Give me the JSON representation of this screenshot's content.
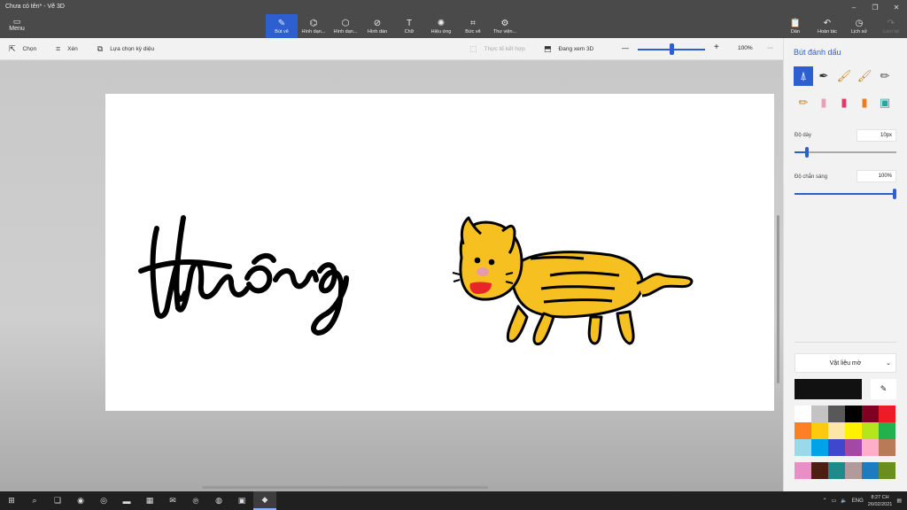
{
  "app": {
    "title": "Chưa có tên* - Vẽ 3D",
    "window_controls": [
      "–",
      "❐",
      "✕"
    ]
  },
  "menu": {
    "label": "Menu"
  },
  "tools": [
    {
      "label": "Bút vẽ",
      "icon": "brush-icon",
      "glyph": "✎",
      "active": true
    },
    {
      "label": "Hình dạn...",
      "icon": "shapes-2d-icon",
      "glyph": "⌬"
    },
    {
      "label": "Hình dạn...",
      "icon": "shapes-3d-icon",
      "glyph": "⬡"
    },
    {
      "label": "Hình dán",
      "icon": "stickers-icon",
      "glyph": "⊘"
    },
    {
      "label": "Chữ",
      "icon": "text-icon",
      "glyph": "T"
    },
    {
      "label": "Hiệu ứng",
      "icon": "effects-icon",
      "glyph": "✺"
    },
    {
      "label": "Bức vẽ",
      "icon": "canvas-icon",
      "glyph": "⌗"
    },
    {
      "label": "Thư viện...",
      "icon": "library-icon",
      "glyph": "⚙"
    }
  ],
  "right_tools": [
    {
      "label": "Dán",
      "icon": "paste-icon",
      "glyph": "📋",
      "enabled": true
    },
    {
      "label": "Hoàn tác",
      "icon": "undo-icon",
      "glyph": "↶",
      "enabled": true
    },
    {
      "label": "Lịch sử",
      "icon": "history-icon",
      "glyph": "◷",
      "enabled": true
    },
    {
      "label": "Làm lại",
      "icon": "redo-icon",
      "glyph": "↷",
      "enabled": false
    }
  ],
  "subbar": {
    "select": "Chọn",
    "crop": "Xén",
    "magic_select": "Lựa chọn kỳ diệu",
    "mixed_reality": "Thực tế kết hợp",
    "view_3d": "Đang xem 3D",
    "zoom_minus": "—",
    "zoom_plus": "+",
    "zoom": "100%",
    "more": "···",
    "zoom_level": 0.5
  },
  "panel": {
    "title": "Bút đánh dấu",
    "brushes": [
      {
        "icon": "marker-icon",
        "glyph": "⍋",
        "active": true,
        "color": "#2d5fd1"
      },
      {
        "icon": "calligraphy-pen-icon",
        "glyph": "✒",
        "color": "#333333"
      },
      {
        "icon": "oil-brush-icon",
        "glyph": "🖌",
        "color": "#c98a2b"
      },
      {
        "icon": "watercolor-icon",
        "glyph": "🖌",
        "color": "#c98a2b"
      },
      {
        "icon": "pixel-pen-icon",
        "glyph": "✏",
        "color": "#555555"
      },
      {
        "icon": "pencil-icon",
        "glyph": "✏",
        "color": "#c98a2b"
      },
      {
        "icon": "eraser-icon",
        "glyph": "▮",
        "color": "#e6a0b8"
      },
      {
        "icon": "crayon-icon",
        "glyph": "▮",
        "color": "#e03a6a"
      },
      {
        "icon": "spray-can-icon",
        "glyph": "▮",
        "color": "#ef7a1a"
      },
      {
        "icon": "fill-bucket-icon",
        "glyph": "▣",
        "color": "#2aa59a"
      }
    ],
    "thickness_label": "Độ dày",
    "thickness_value": "10px",
    "thickness_level": 0.1,
    "opacity_label": "Độ chắn sáng",
    "opacity_value": "100%",
    "opacity_level": 1.0,
    "material": "Vật liệu mờ",
    "current_color": "#111111",
    "palette": [
      "#ffffff",
      "#c3c3c3",
      "#585858",
      "#000000",
      "#7f0020",
      "#ed1c24",
      "#ff7f27",
      "#ffc90e",
      "#fde7a8",
      "#fff200",
      "#b5e61d",
      "#22b14c",
      "#99d9ea",
      "#00a2e8",
      "#3f48cc",
      "#a349a4",
      "#ffaec9",
      "#b97a57"
    ],
    "palette_custom": [
      "#e88fc7",
      "#4d1f12",
      "#1f8a8a",
      "#b29a9a",
      "#1f7bbf",
      "#6a8f1f"
    ]
  },
  "canvas": {
    "text_art": "Hương",
    "drawing": "yellow-cat-drawing"
  },
  "taskbar": {
    "apps": [
      {
        "icon": "windows-start-icon",
        "glyph": "⊞"
      },
      {
        "icon": "search-icon",
        "glyph": "⌕"
      },
      {
        "icon": "task-view-icon",
        "glyph": "❏"
      },
      {
        "icon": "edge-icon",
        "glyph": "◉"
      },
      {
        "icon": "chrome-icon",
        "glyph": "◎"
      },
      {
        "icon": "file-explorer-icon",
        "glyph": "▬"
      },
      {
        "icon": "store-icon",
        "glyph": "▦"
      },
      {
        "icon": "mail-icon",
        "glyph": "✉"
      },
      {
        "icon": "pinterest-icon",
        "glyph": "℗"
      },
      {
        "icon": "spotify-icon",
        "glyph": "◍"
      },
      {
        "icon": "zoom-icon",
        "glyph": "▣"
      },
      {
        "icon": "paint-3d-icon",
        "glyph": "◆",
        "active": true
      }
    ],
    "tray": {
      "lang": "ENG",
      "time": "8:27 CH",
      "date": "26/02/2021"
    }
  }
}
